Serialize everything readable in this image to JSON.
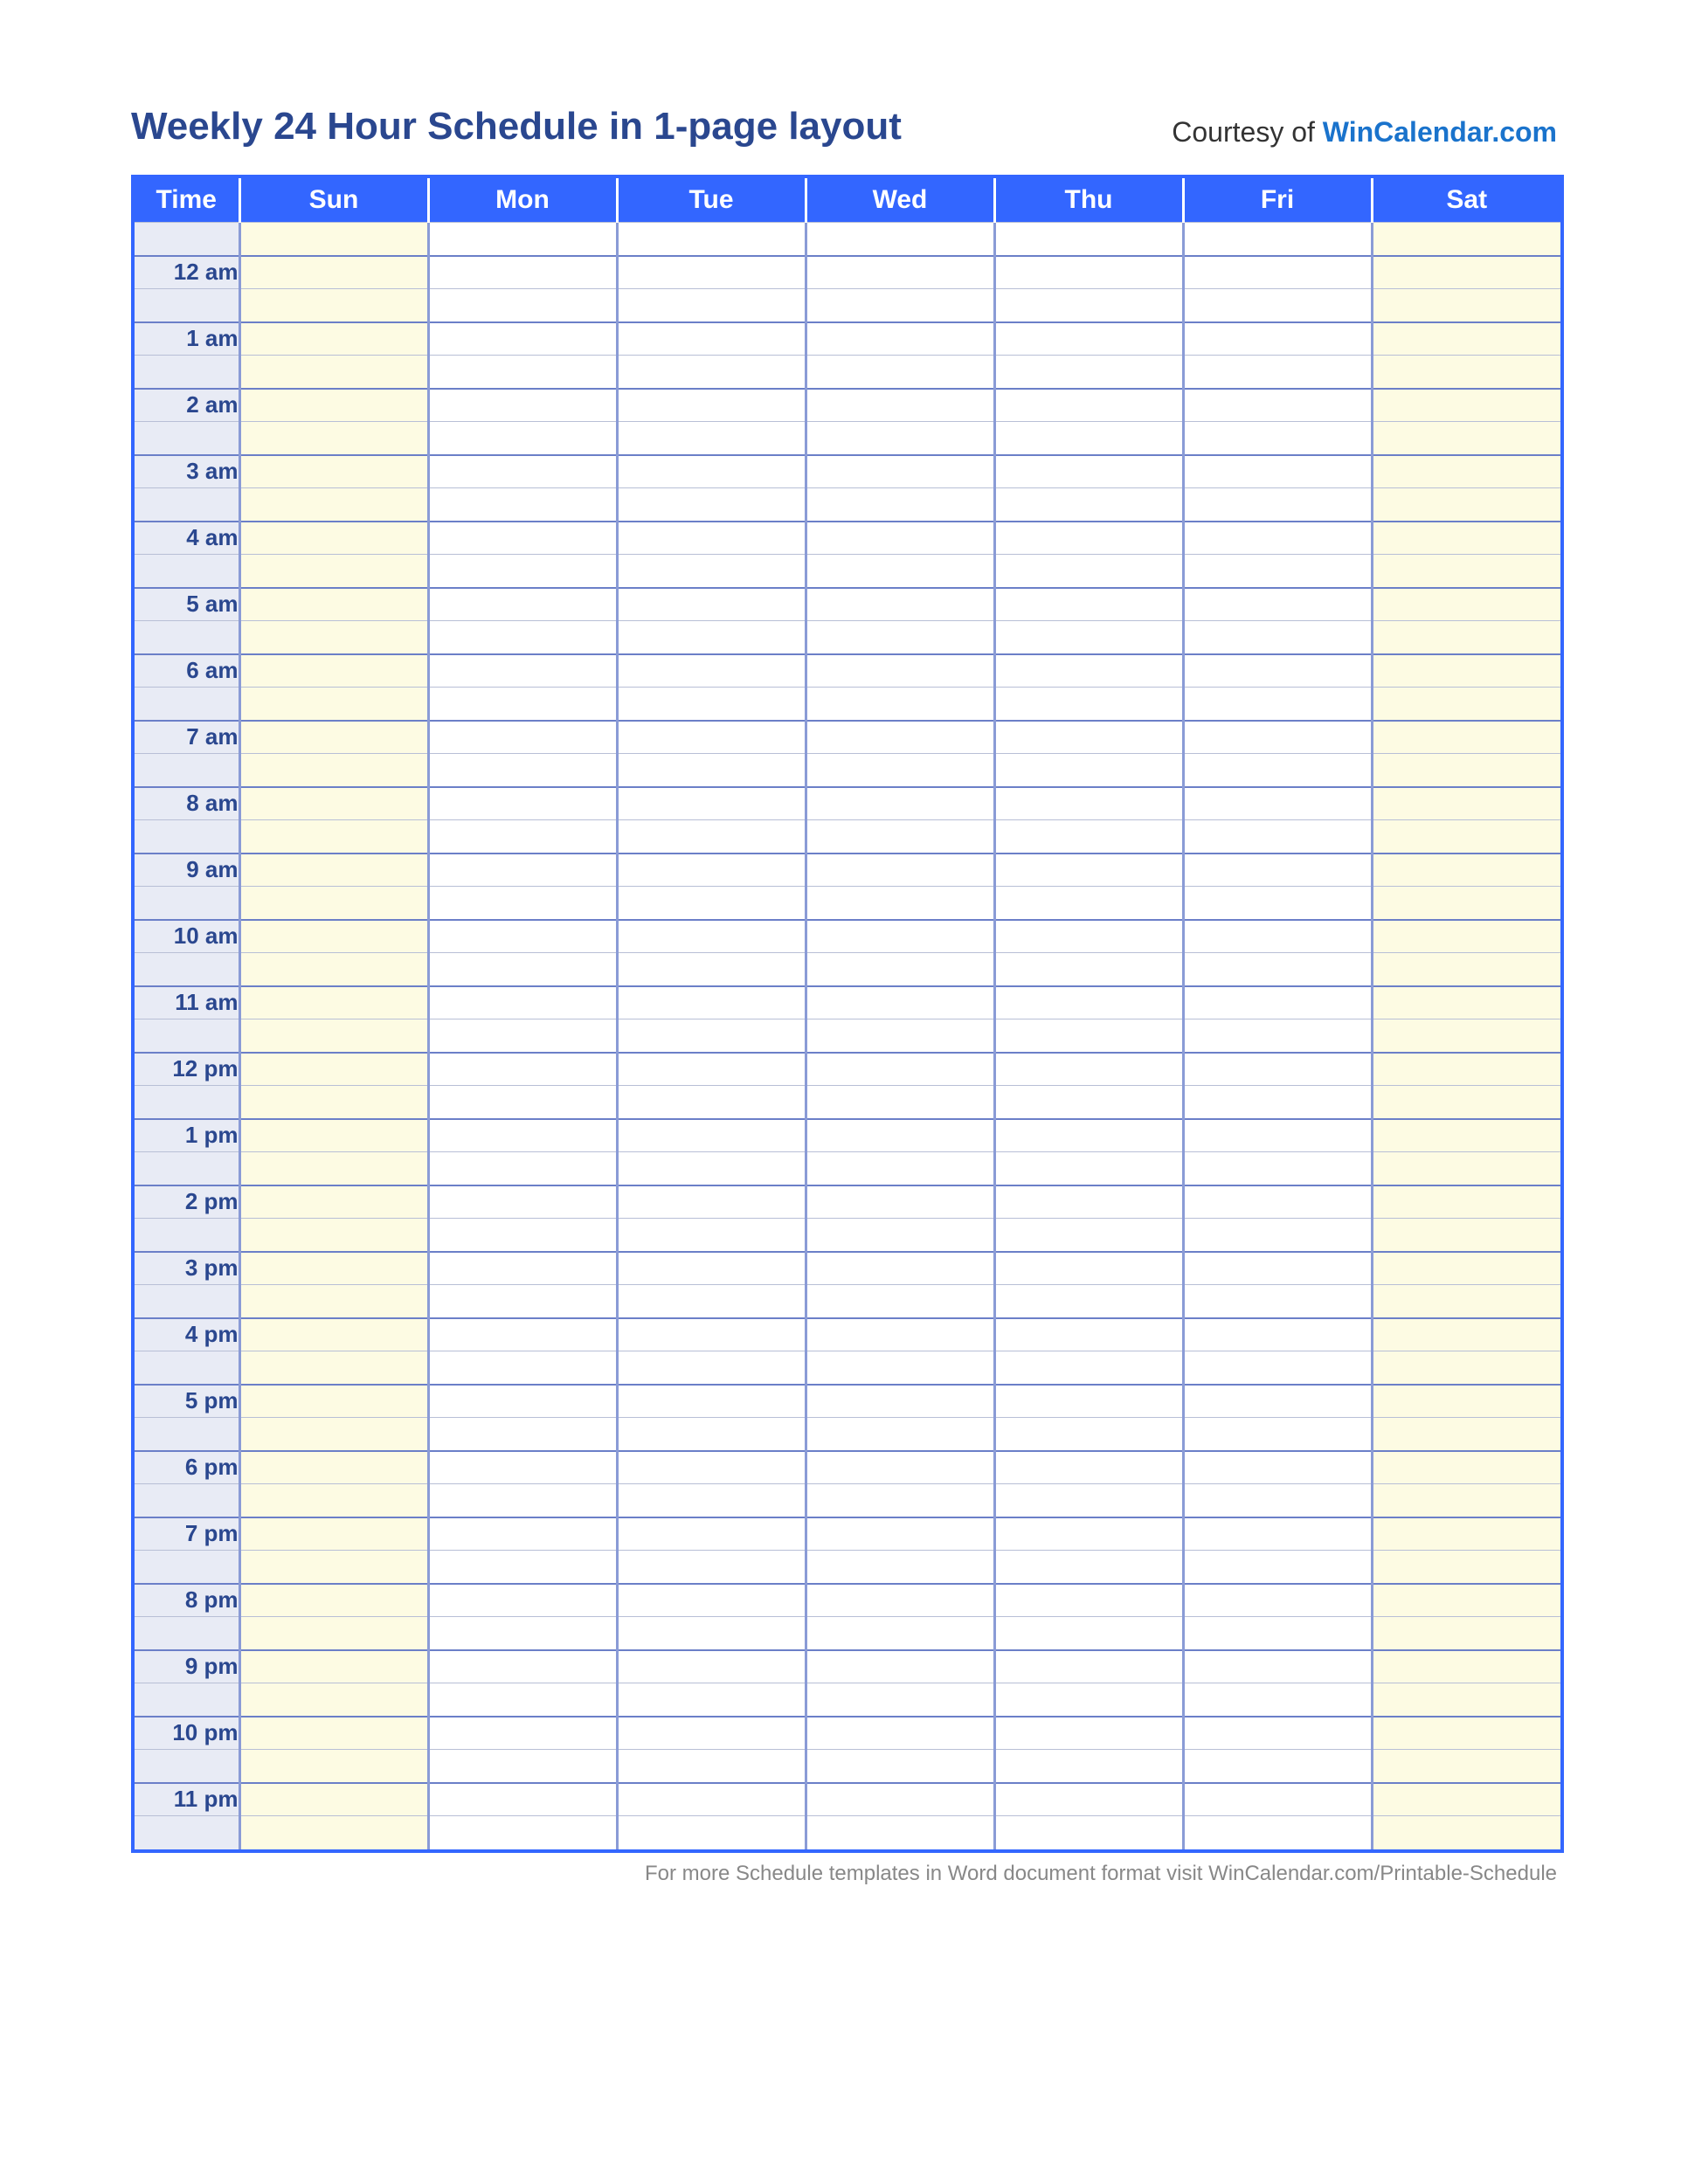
{
  "header": {
    "title": "Weekly 24 Hour Schedule in 1-page layout",
    "courtesy_prefix": "Courtesy of ",
    "courtesy_link": "WinCalendar.com"
  },
  "columns": {
    "time": "Time",
    "days": [
      "Sun",
      "Mon",
      "Tue",
      "Wed",
      "Thu",
      "Fri",
      "Sat"
    ]
  },
  "hours": [
    "12 am",
    "1 am",
    "2 am",
    "3 am",
    "4 am",
    "5 am",
    "6 am",
    "7 am",
    "8 am",
    "9 am",
    "10 am",
    "11 am",
    "12 pm",
    "1 pm",
    "2 pm",
    "3 pm",
    "4 pm",
    "5 pm",
    "6 pm",
    "7 pm",
    "8 pm",
    "9 pm",
    "10 pm",
    "11 pm"
  ],
  "grid": {
    "leading_blank_row": true,
    "subrows_per_hour": 2,
    "weekend_day_indexes": [
      0,
      6
    ]
  },
  "footer": {
    "text_prefix": "For more Schedule templates in Word document format visit ",
    "link_text": "WinCalendar.com/Printable-Schedule"
  }
}
